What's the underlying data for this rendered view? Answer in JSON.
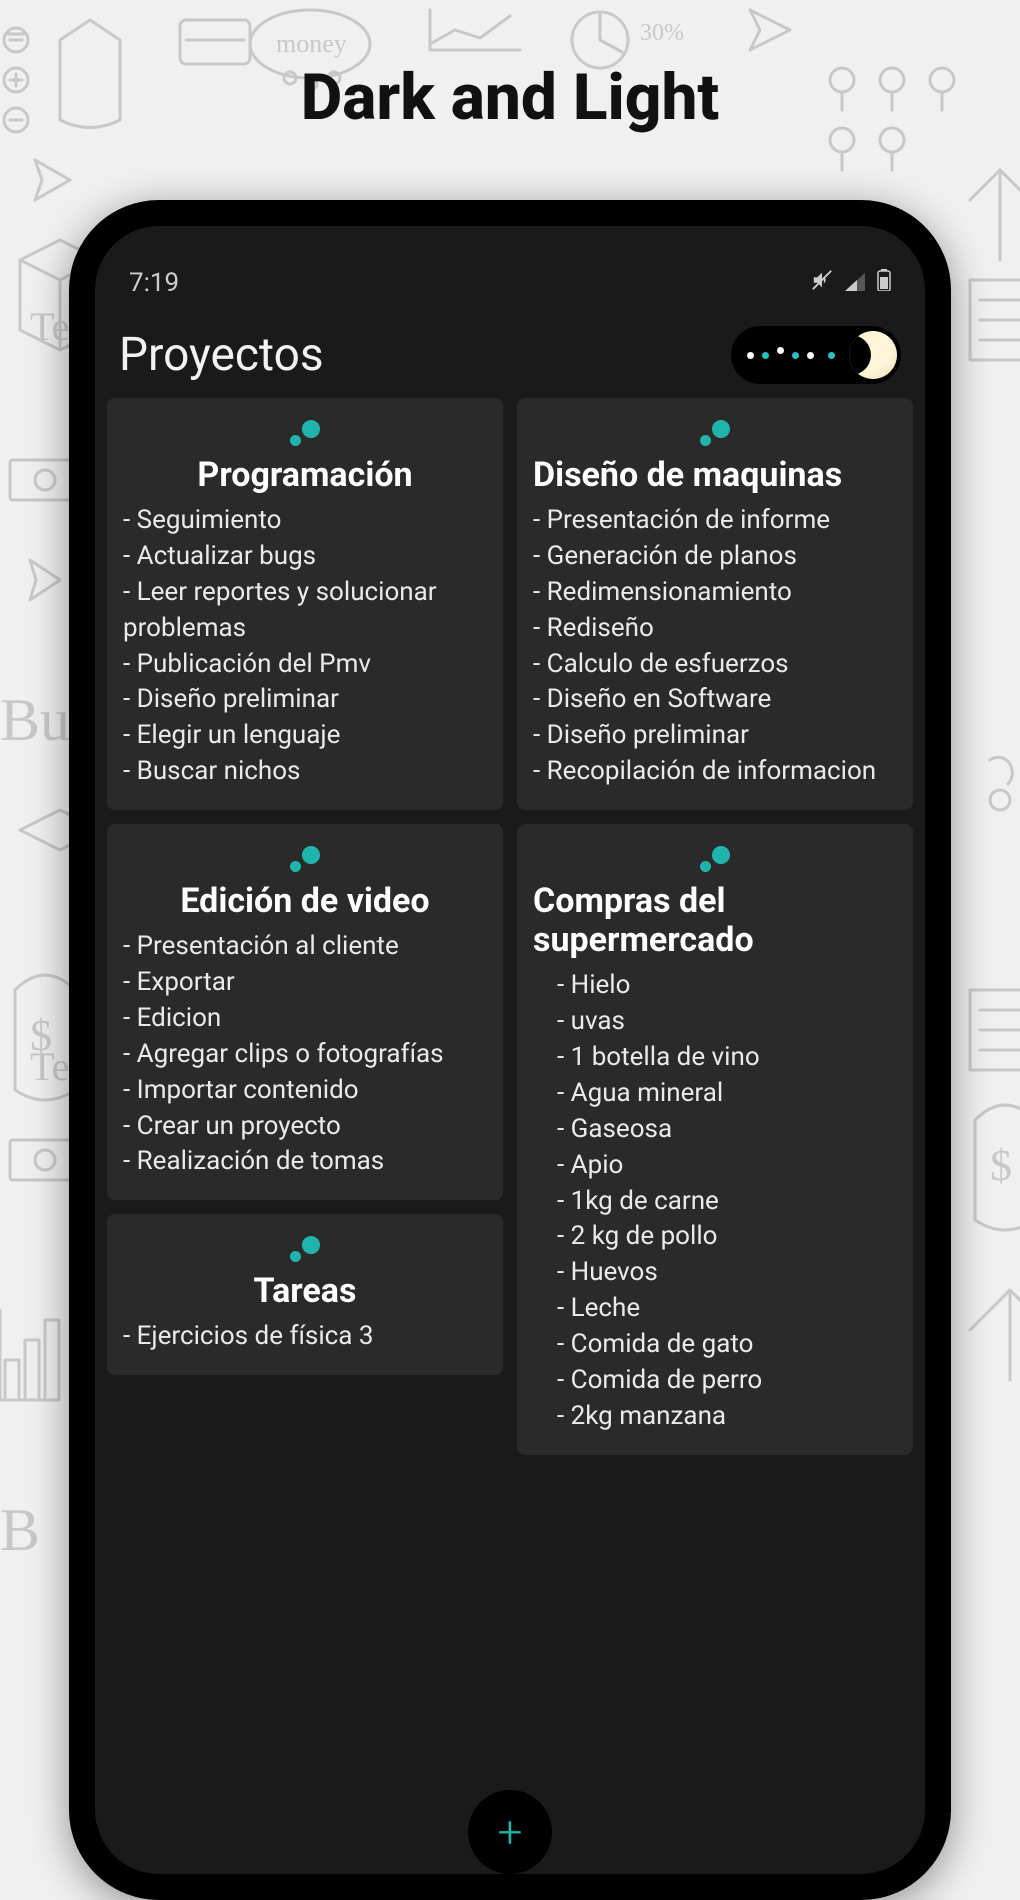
{
  "promo": {
    "title": "Dark and Light"
  },
  "status": {
    "time": "7:19"
  },
  "header": {
    "title": "Proyectos"
  },
  "cards": {
    "programacion": {
      "title": "Programación",
      "items": [
        "Seguimiento",
        "Actualizar bugs",
        "Leer reportes y solucionar problemas",
        "Publicación del Pmv",
        "Diseño preliminar",
        "Elegir un lenguaje",
        "Buscar nichos"
      ]
    },
    "diseno_maquinas": {
      "title": "Diseño de maquinas",
      "items": [
        "Presentación de informe",
        "Generación de planos",
        "Redimensionamiento",
        "Rediseño",
        "Calculo de esfuerzos",
        "Diseño en Software",
        "Diseño preliminar",
        "Recopilación de informacion"
      ]
    },
    "edicion_video": {
      "title": "Edición de video",
      "items": [
        "Presentación al cliente",
        "Exportar",
        "Edicion",
        "Agregar clips o fotografías",
        "Importar contenido",
        "Crear un proyecto",
        "Realización de tomas"
      ]
    },
    "compras": {
      "title": "Compras del supermercado",
      "items": [
        "Hielo",
        "uvas",
        "1 botella de vino",
        "Agua mineral",
        "Gaseosa",
        "Apio",
        "1kg  de carne",
        "2 kg de pollo",
        "Huevos",
        "Leche",
        "Comida de gato",
        "Comida de perro",
        "2kg manzana"
      ]
    },
    "tareas": {
      "title": "Tareas",
      "items": [
        "Ejercicios de física 3"
      ]
    }
  }
}
